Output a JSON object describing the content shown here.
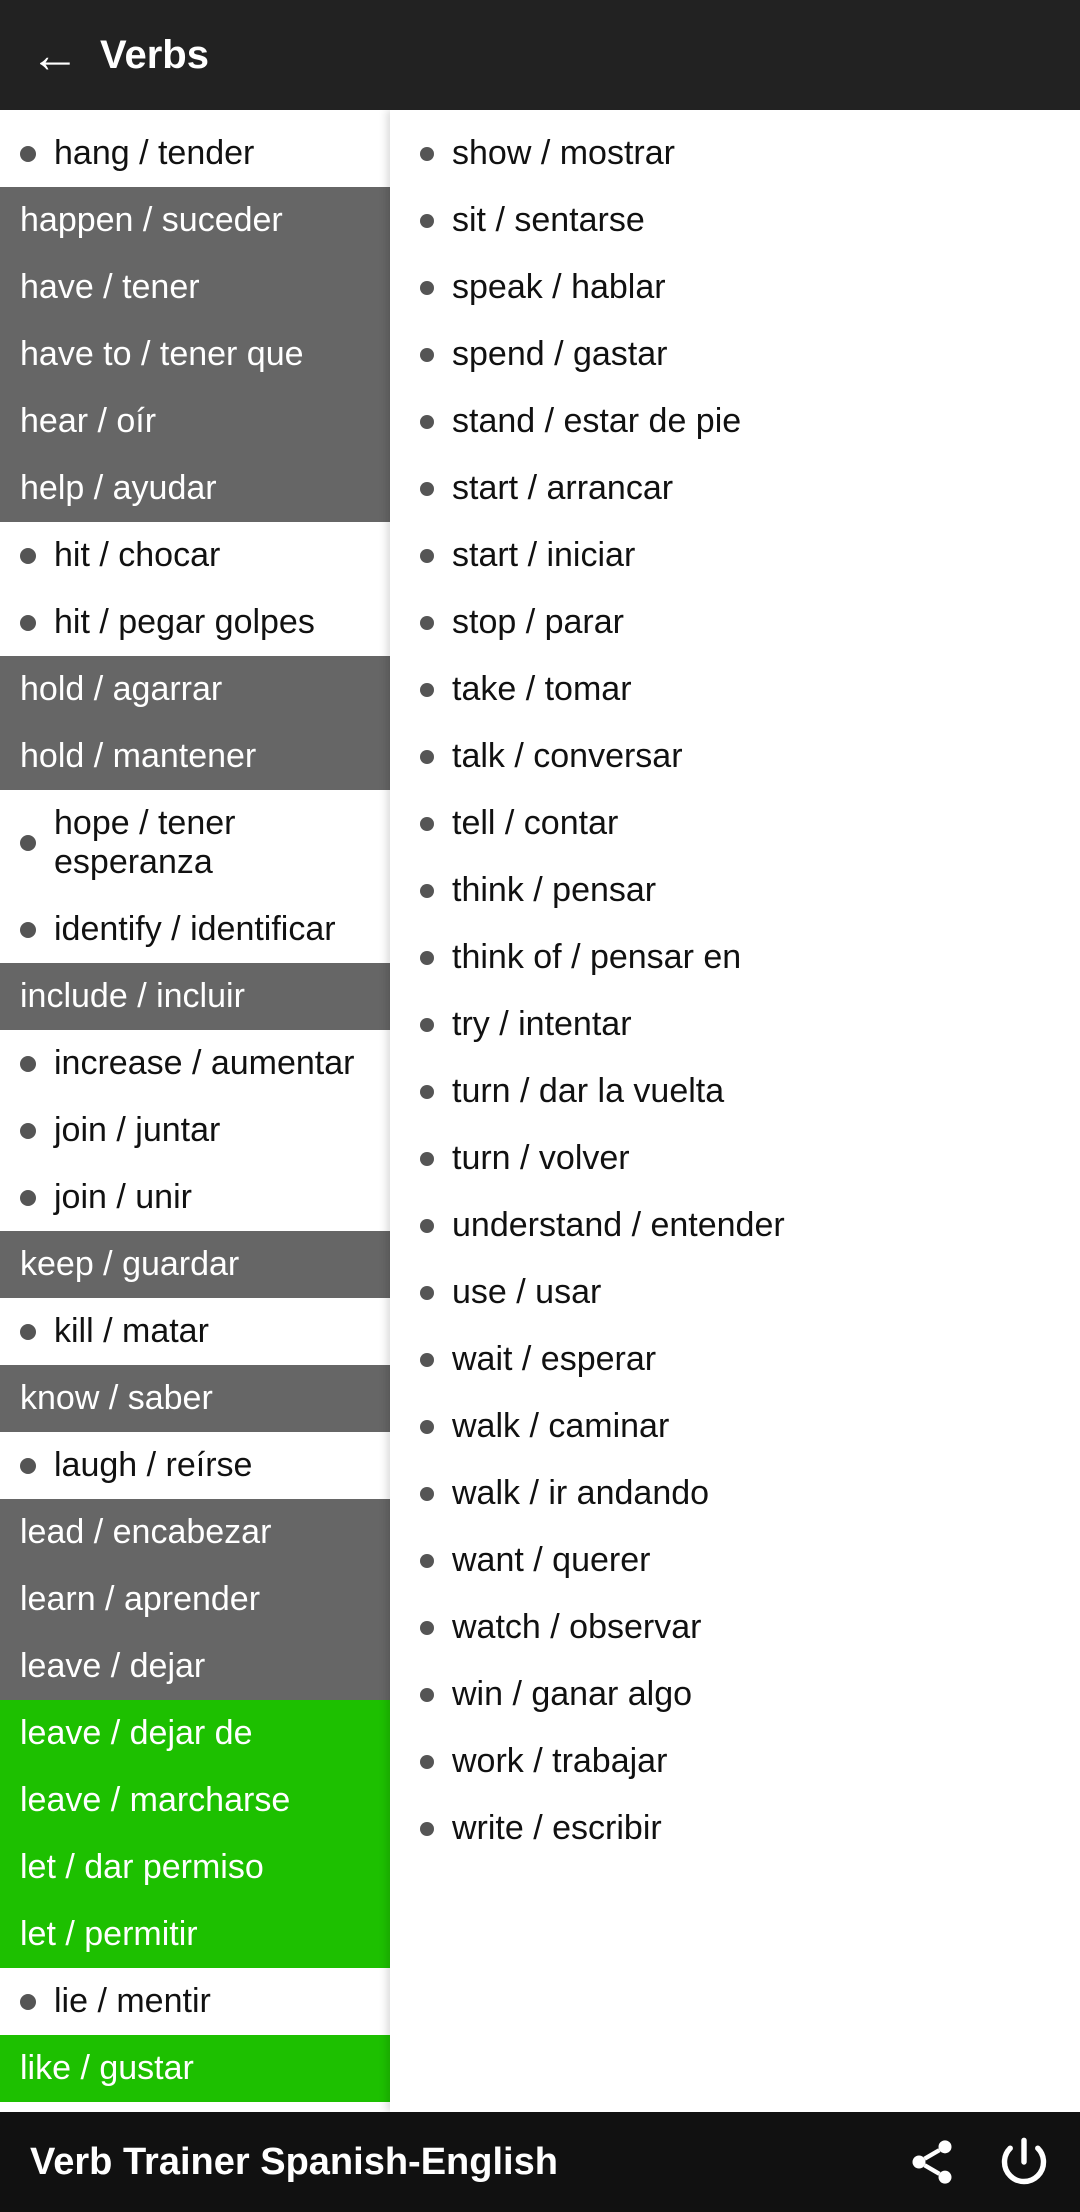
{
  "topBar": {
    "title": "Verbs",
    "backLabel": "←"
  },
  "bottomBar": {
    "title": "Verb Trainer Spanish-English"
  },
  "leftItems": [
    {
      "text": "hang / tender",
      "style": "normal"
    },
    {
      "text": "happen / suceder",
      "style": "highlighted"
    },
    {
      "text": "have / tener",
      "style": "highlighted"
    },
    {
      "text": "have to / tener que",
      "style": "highlighted"
    },
    {
      "text": "hear / oír",
      "style": "highlighted"
    },
    {
      "text": "help / ayudar",
      "style": "highlighted"
    },
    {
      "text": "hit / chocar",
      "style": "normal"
    },
    {
      "text": "hit / pegar golpes",
      "style": "normal"
    },
    {
      "text": "hold / agarrar",
      "style": "highlighted"
    },
    {
      "text": "hold / mantener",
      "style": "highlighted"
    },
    {
      "text": "hope / tener esperanza",
      "style": "normal"
    },
    {
      "text": "identify / identificar",
      "style": "normal"
    },
    {
      "text": "include / incluir",
      "style": "highlighted"
    },
    {
      "text": "increase / aumentar",
      "style": "normal"
    },
    {
      "text": "join / juntar",
      "style": "normal"
    },
    {
      "text": "join / unir",
      "style": "normal"
    },
    {
      "text": "keep / guardar",
      "style": "highlighted"
    },
    {
      "text": "kill / matar",
      "style": "normal"
    },
    {
      "text": "know / saber",
      "style": "highlighted"
    },
    {
      "text": "laugh / reírse",
      "style": "normal"
    },
    {
      "text": "lead / encabezar",
      "style": "highlighted"
    },
    {
      "text": "learn / aprender",
      "style": "highlighted"
    },
    {
      "text": "leave / dejar",
      "style": "highlighted"
    },
    {
      "text": "leave / dejar de",
      "style": "green"
    },
    {
      "text": "leave / marcharse",
      "style": "green"
    },
    {
      "text": "let / dar permiso",
      "style": "green"
    },
    {
      "text": "let / permitir",
      "style": "green"
    },
    {
      "text": "lie / mentir",
      "style": "normal"
    },
    {
      "text": "like / gustar",
      "style": "green"
    }
  ],
  "rightItems": [
    {
      "text": "show / mostrar"
    },
    {
      "text": "sit / sentarse"
    },
    {
      "text": "speak / hablar"
    },
    {
      "text": "spend / gastar"
    },
    {
      "text": "stand / estar de pie"
    },
    {
      "text": "start / arrancar"
    },
    {
      "text": "start / iniciar"
    },
    {
      "text": "stop / parar"
    },
    {
      "text": "take / tomar"
    },
    {
      "text": "talk / conversar"
    },
    {
      "text": "tell / contar"
    },
    {
      "text": "think / pensar"
    },
    {
      "text": "think of / pensar en"
    },
    {
      "text": "try / intentar"
    },
    {
      "text": "turn / dar la vuelta"
    },
    {
      "text": "turn / volver"
    },
    {
      "text": "understand / entender"
    },
    {
      "text": "use / usar"
    },
    {
      "text": "wait / esperar"
    },
    {
      "text": "walk / caminar"
    },
    {
      "text": "walk / ir andando"
    },
    {
      "text": "want / querer"
    },
    {
      "text": "watch / observar"
    },
    {
      "text": "win / ganar algo"
    },
    {
      "text": "work / trabajar"
    },
    {
      "text": "write / escribir"
    }
  ]
}
